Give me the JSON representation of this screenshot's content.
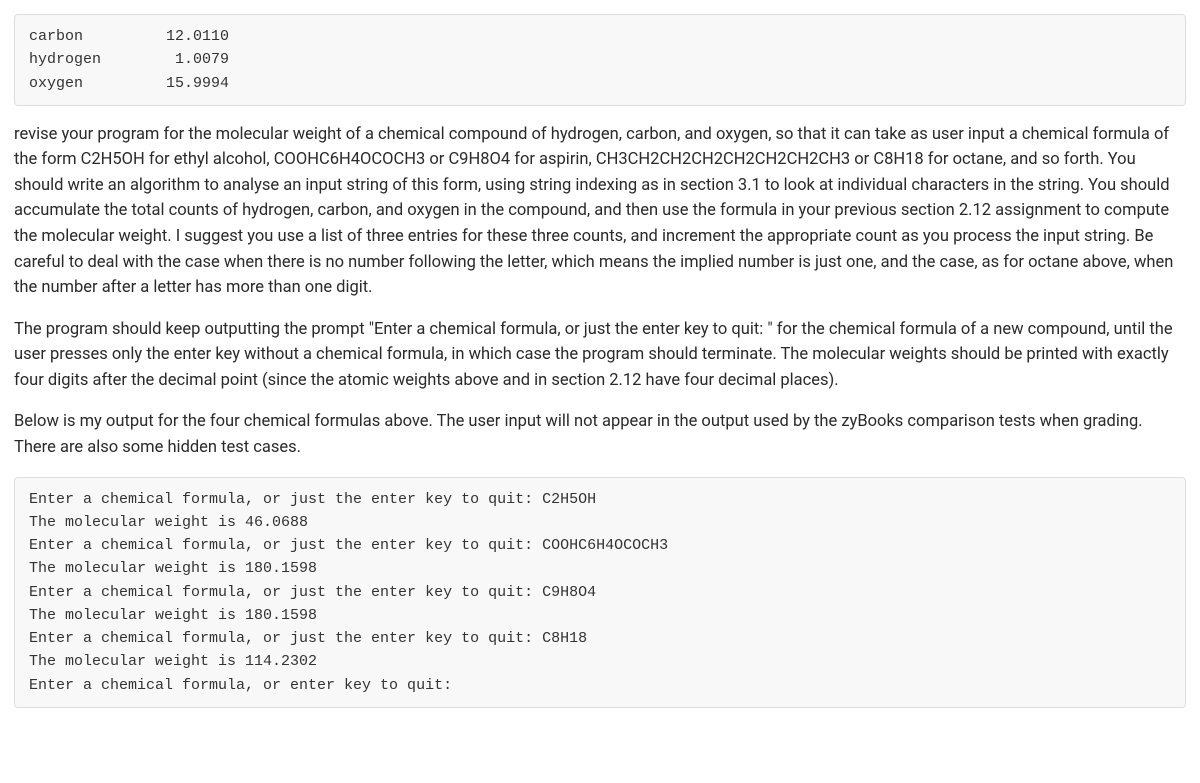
{
  "atomic_weights": [
    {
      "element": "carbon",
      "weight": "12.0110"
    },
    {
      "element": "hydrogen",
      "weight": " 1.0079"
    },
    {
      "element": "oxygen",
      "weight": "15.9994"
    }
  ],
  "paragraphs": {
    "p1": "revise your program for the molecular weight of a chemical compound of hydrogen, carbon, and oxygen, so that it can take as user input a chemical formula of the form C2H5OH for ethyl alcohol, COOHC6H4OCOCH3 or C9H8O4 for aspirin, CH3CH2CH2CH2CH2CH2CH2CH3 or C8H18 for octane, and so forth. You should write an algorithm to analyse an input string of this form, using string indexing as in section 3.1 to look at individual characters in the string. You should accumulate the total counts of hydrogen, carbon, and oxygen in the compound, and then use the formula in your previous section 2.12 assignment to compute the molecular weight. I suggest you use a list of three entries for these three counts, and increment the appropriate count as you process the input string. Be careful to deal with the case when there is no number following the letter, which means the implied number is just one, and the case, as for octane above, when the number after a letter has more than one digit.",
    "p2": "The program should keep outputting the prompt \"Enter a chemical formula, or just the enter key to quit: \" for the chemical formula of a new compound, until the user presses only the enter key without a chemical formula, in which case the program should terminate. The molecular weights should be printed with exactly four digits after the decimal point (since the atomic weights above and in section 2.12 have four decimal places).",
    "p3": "Below is my output for the four chemical formulas above. The user input will not appear in the output used by the zyBooks comparison tests when grading. There are also some hidden test cases."
  },
  "sample_output": [
    "Enter a chemical formula, or just the enter key to quit: C2H5OH",
    "The molecular weight is 46.0688",
    "Enter a chemical formula, or just the enter key to quit: COOHC6H4OCOCH3",
    "The molecular weight is 180.1598",
    "Enter a chemical formula, or just the enter key to quit: C9H8O4",
    "The molecular weight is 180.1598",
    "Enter a chemical formula, or just the enter key to quit: C8H18",
    "The molecular weight is 114.2302",
    "Enter a chemical formula, or enter key to quit:"
  ]
}
